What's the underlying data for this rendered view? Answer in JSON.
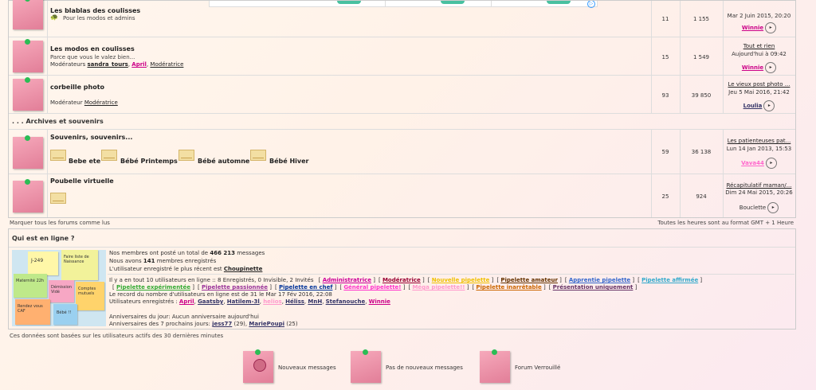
{
  "forums": [
    {
      "title": "Les blablas des coulisses",
      "desc": "Pour les modos et admins",
      "topics": "11",
      "posts": "1 155",
      "last": {
        "date": "Mar 2 Juin 2015, 20:20",
        "user": "Winnie"
      }
    },
    {
      "title": "Les modos en coulisses",
      "desc": "Parce que vous le valez bien...",
      "mods_prefix": "Modérateurs",
      "mods": [
        "sandra_tours",
        ", ",
        "April",
        ", ",
        "Modératrice"
      ],
      "topics": "15",
      "posts": "1 549",
      "last": {
        "topic": "Tout et rien",
        "date": "Aujourd'hui à 09:42",
        "user": "Winnie"
      }
    },
    {
      "title": "corbeille photo",
      "mods_prefix": "Modérateur",
      "mods": [
        "Modératrice"
      ],
      "topics": "93",
      "posts": "39 850",
      "last": {
        "topic": "Le vieux post photo ...",
        "date": "Jeu 5 Mai 2016, 21:42",
        "user": "Loulia"
      }
    },
    {
      "title": "Souvenirs, souvenirs...",
      "subforums": [
        "Bebe ete",
        "Bébé Printemps",
        "Bébé automne",
        "Bébé Hiver"
      ],
      "topics": "59",
      "posts": "36 138",
      "last": {
        "topic": "Les patienteuses pat...",
        "date": "Lun 14 Jan 2013, 15:53",
        "user": "Vava44"
      }
    },
    {
      "title": "Poubelle virtuelle",
      "topics": "25",
      "posts": "924",
      "last": {
        "topic": "Récapitulatif maman/...",
        "date": "Dim 24 Mai 2015, 20:26",
        "user": "Bouclette"
      }
    }
  ],
  "category": ". . . Archives et souvenirs",
  "footer": {
    "mark_read": "Marquer tous les forums comme lus",
    "timezone": "Toutes les heures sont au format GMT + 1 Heure"
  },
  "online": {
    "title": "Qui est en ligne ?",
    "stats": {
      "l1a": "Nos membres ont posté un total de ",
      "total_posts": "466 213",
      "l1b": " messages",
      "l2a": "Nous avons ",
      "members": "141",
      "l2b": " membres enregistrés",
      "l3a": "L'utilisateur enregistré le plus récent est ",
      "newest": "Choupinette"
    },
    "users_line": "Il y a en tout 10 utilisateurs en ligne :: 8 Enregistrés, 0 Invisible, 2 Invités",
    "groups": [
      {
        "name": "Administratrice",
        "color": "#cc0099"
      },
      {
        "name": "Modératrice",
        "color": "#990033"
      },
      {
        "name": "Nouvelle pipelette",
        "color": "#f0c000"
      },
      {
        "name": "Pipelette amateur",
        "color": "#663300"
      },
      {
        "name": "Apprentie pipelette",
        "color": "#3366cc"
      },
      {
        "name": "Pipelette affirmée",
        "color": "#33aacc"
      },
      {
        "name": "Pipelette expérimentée",
        "color": "#33aa33"
      },
      {
        "name": "Pipelette passionnée",
        "color": "#993399"
      },
      {
        "name": "Pipelette en chef",
        "color": "#003399"
      },
      {
        "name": "Général pipelette!",
        "color": "#ff33cc"
      },
      {
        "name": "Méga pipelette!!",
        "color": "#ff99cc"
      },
      {
        "name": "Pipelette inarrêtable",
        "color": "#cc6600"
      },
      {
        "name": "Présentation uniquement",
        "color": "#663366"
      }
    ],
    "record": "Le record du nombre d'utilisateurs en ligne est de 31 le Mar 17 Fév 2016, 22:08",
    "registered_prefix": "Utilisateurs enregistrés : ",
    "registered": [
      {
        "name": "April",
        "color": "#cc0088"
      },
      {
        "name": "Gaatsby",
        "color": "#333366"
      },
      {
        "name": "Hatilem-3l",
        "color": "#333366"
      },
      {
        "name": "helios",
        "color": "#ff99cc"
      },
      {
        "name": "Héliss",
        "color": "#333366"
      },
      {
        "name": "MnH",
        "color": "#333366"
      },
      {
        "name": "Stefanouche",
        "color": "#333366"
      },
      {
        "name": "Winnie",
        "color": "#cc0088"
      }
    ],
    "birthday_today": "Anniversaires du jour: Aucun anniversaire aujourd'hui",
    "birthday_next_prefix": "Anniversaires des 7 prochains jours: ",
    "birthday_next": [
      {
        "name": "jess77",
        "age": "(29)"
      },
      {
        "name": "MariePoupi",
        "age": "(25)"
      }
    ],
    "collage_text": [
      "J-249",
      "Faire liste de Naissance",
      "Maternité 22h",
      "Démission Vidé",
      "Bébé !!",
      "Comptes mutuels",
      "Rendez vous CAF"
    ]
  },
  "data_note": "Ces données sont basées sur les utilisateurs actifs des 30 dernières minutes",
  "legend": [
    "Nouveaux messages",
    "Pas de nouveaux messages",
    "Forum Verrouillé"
  ]
}
